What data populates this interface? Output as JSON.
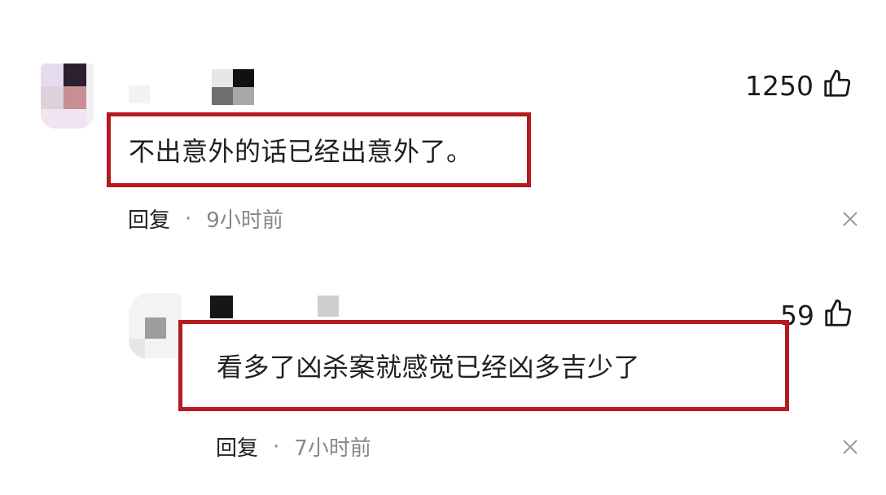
{
  "comments": [
    {
      "text": "不出意外的话已经出意外了。",
      "reply_label": "回复",
      "separator": "·",
      "time": "9小时前",
      "likes": "1250"
    },
    {
      "text": "看多了凶杀案就感觉已经凶多吉少了",
      "reply_label": "回复",
      "separator": "·",
      "time": "7小时前",
      "likes": "59"
    }
  ],
  "icons": {
    "like": "thumbs-up-icon",
    "close": "close-icon"
  },
  "colors": {
    "highlight_border": "#b41a1f",
    "muted_text": "#888888"
  }
}
